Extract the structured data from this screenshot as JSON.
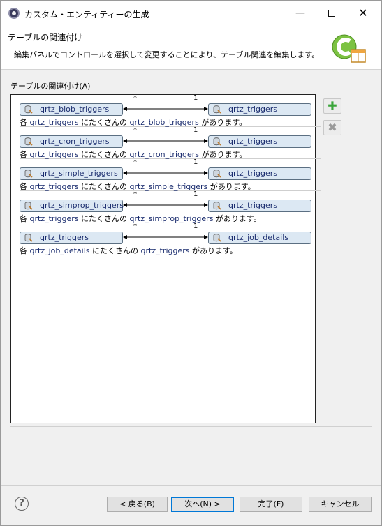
{
  "window": {
    "title": "カスタム・エンティティーの生成",
    "minimize_label": "—",
    "close_label": "✕"
  },
  "banner": {
    "title": "テーブルの関連付け",
    "description": "編集パネルでコントロールを選択して変更することにより、テーブル関連を編集します。"
  },
  "section_label": "テーブルの関連付け(A)",
  "relationships": [
    {
      "many_label": "*",
      "one_label": "1",
      "left_table": "qrtz_blob_triggers",
      "right_table": "qrtz_triggers",
      "desc_prefix": "各",
      "desc_one": "qrtz_triggers",
      "desc_mid": "にたくさんの",
      "desc_many": "qrtz_blob_triggers",
      "desc_suffix": "があります。"
    },
    {
      "many_label": "*",
      "one_label": "1",
      "left_table": "qrtz_cron_triggers",
      "right_table": "qrtz_triggers",
      "desc_prefix": "各",
      "desc_one": "qrtz_triggers",
      "desc_mid": "にたくさんの",
      "desc_many": "qrtz_cron_triggers",
      "desc_suffix": "があります。"
    },
    {
      "many_label": "*",
      "one_label": "1",
      "left_table": "qrtz_simple_triggers",
      "right_table": "qrtz_triggers",
      "desc_prefix": "各",
      "desc_one": "qrtz_triggers",
      "desc_mid": "にたくさんの",
      "desc_many": "qrtz_simple_triggers",
      "desc_suffix": "があります。"
    },
    {
      "many_label": "*",
      "one_label": "1",
      "left_table": "qrtz_simprop_triggers",
      "right_table": "qrtz_triggers",
      "desc_prefix": "各",
      "desc_one": "qrtz_triggers",
      "desc_mid": "にたくさんの",
      "desc_many": "qrtz_simprop_triggers",
      "desc_suffix": "があります。"
    },
    {
      "many_label": "*",
      "one_label": "1",
      "left_table": "qrtz_triggers",
      "right_table": "qrtz_job_details",
      "desc_prefix": "各",
      "desc_one": "qrtz_job_details",
      "desc_mid": "にたくさんの",
      "desc_many": "qrtz_triggers",
      "desc_suffix": "があります。"
    }
  ],
  "side_buttons": {
    "add_icon": "plus-icon",
    "remove_icon": "delete-icon"
  },
  "footer": {
    "help_label": "?",
    "back_label": "< 戻る(B)",
    "next_label": "次へ(N) >",
    "finish_label": "完了(F)",
    "cancel_label": "キャンセル"
  }
}
